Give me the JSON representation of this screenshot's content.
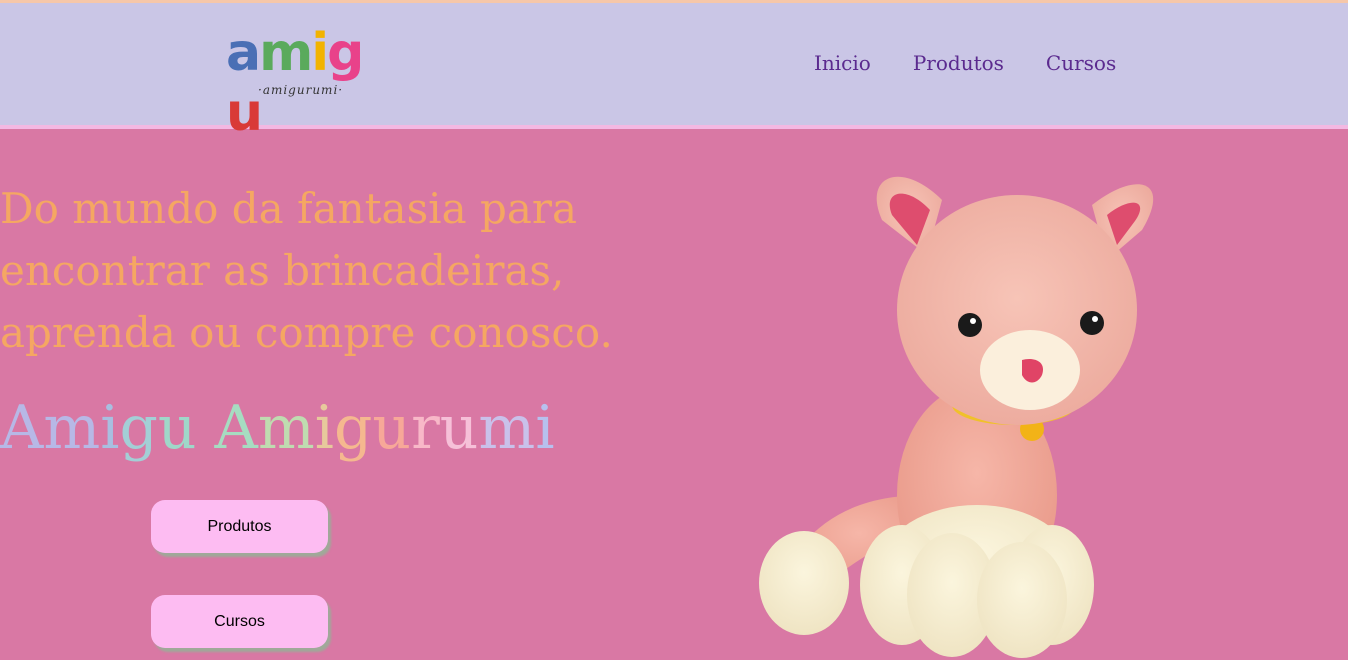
{
  "logo": {
    "letters": [
      {
        "char": "a",
        "color": "#4a6fb5"
      },
      {
        "char": "m",
        "color": "#5aaa5c"
      },
      {
        "char": "i",
        "color": "#f2b300"
      },
      {
        "char": "g",
        "color": "#e9428a"
      },
      {
        "char": "u",
        "color": "#d93a37"
      }
    ],
    "subtitle": "·amigurumi·"
  },
  "nav": {
    "items": [
      "Inicio",
      "Produtos",
      "Cursos"
    ]
  },
  "hero": {
    "headline_lines": [
      "Do mundo da fantasia para",
      "encontrar as brincadeiras,",
      "aprenda ou compre conosco."
    ],
    "brand_letters": [
      {
        "char": "A",
        "color": "#b7b8e6"
      },
      {
        "char": "m",
        "color": "#b7b8e6"
      },
      {
        "char": "i",
        "color": "#a8bfe0"
      },
      {
        "char": "g",
        "color": "#a3cfd6"
      },
      {
        "char": "u",
        "color": "#9fd7c9"
      },
      {
        "char": " ",
        "color": "#9fd7c9"
      },
      {
        "char": "A",
        "color": "#a6dcc1"
      },
      {
        "char": "m",
        "color": "#bfdcb0"
      },
      {
        "char": "i",
        "color": "#e7c99c"
      },
      {
        "char": "g",
        "color": "#f5b88f"
      },
      {
        "char": "u",
        "color": "#f7a898"
      },
      {
        "char": "r",
        "color": "#f8b8c8"
      },
      {
        "char": "u",
        "color": "#f6c0d8"
      },
      {
        "char": "m",
        "color": "#c9c1ea"
      },
      {
        "char": "i",
        "color": "#b7c0ee"
      }
    ]
  },
  "buttons": {
    "products": "Produtos",
    "courses": "Cursos"
  },
  "colors": {
    "background": "#d978a4",
    "header": "#cac6e6",
    "headline": "#f5a762",
    "nav_text": "#5b2a8f",
    "button": "#fdbcf2"
  },
  "image": {
    "subject": "pink crochet amigurumi cat"
  }
}
